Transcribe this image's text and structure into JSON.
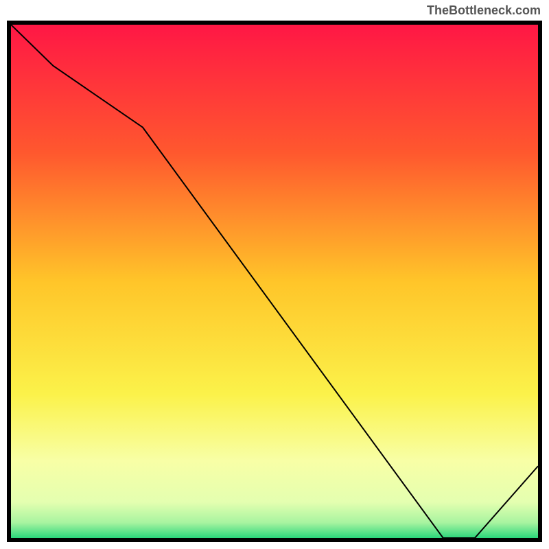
{
  "watermark": "TheBottleneck.com",
  "chart_data": {
    "type": "line",
    "title": "",
    "xlabel": "",
    "ylabel": "",
    "xlim": [
      0,
      100
    ],
    "ylim": [
      0,
      100
    ],
    "x": [
      0,
      8,
      25,
      82,
      88,
      100
    ],
    "values": [
      100,
      92,
      80,
      0,
      0,
      14
    ],
    "gradient_stops": [
      {
        "offset": 0.0,
        "color": "#ff1745"
      },
      {
        "offset": 0.25,
        "color": "#ff582e"
      },
      {
        "offset": 0.5,
        "color": "#ffc529"
      },
      {
        "offset": 0.72,
        "color": "#fbf24a"
      },
      {
        "offset": 0.85,
        "color": "#f8ffa6"
      },
      {
        "offset": 0.93,
        "color": "#e4ffb0"
      },
      {
        "offset": 0.97,
        "color": "#a8f4a0"
      },
      {
        "offset": 1.0,
        "color": "#2bd67b"
      }
    ]
  }
}
